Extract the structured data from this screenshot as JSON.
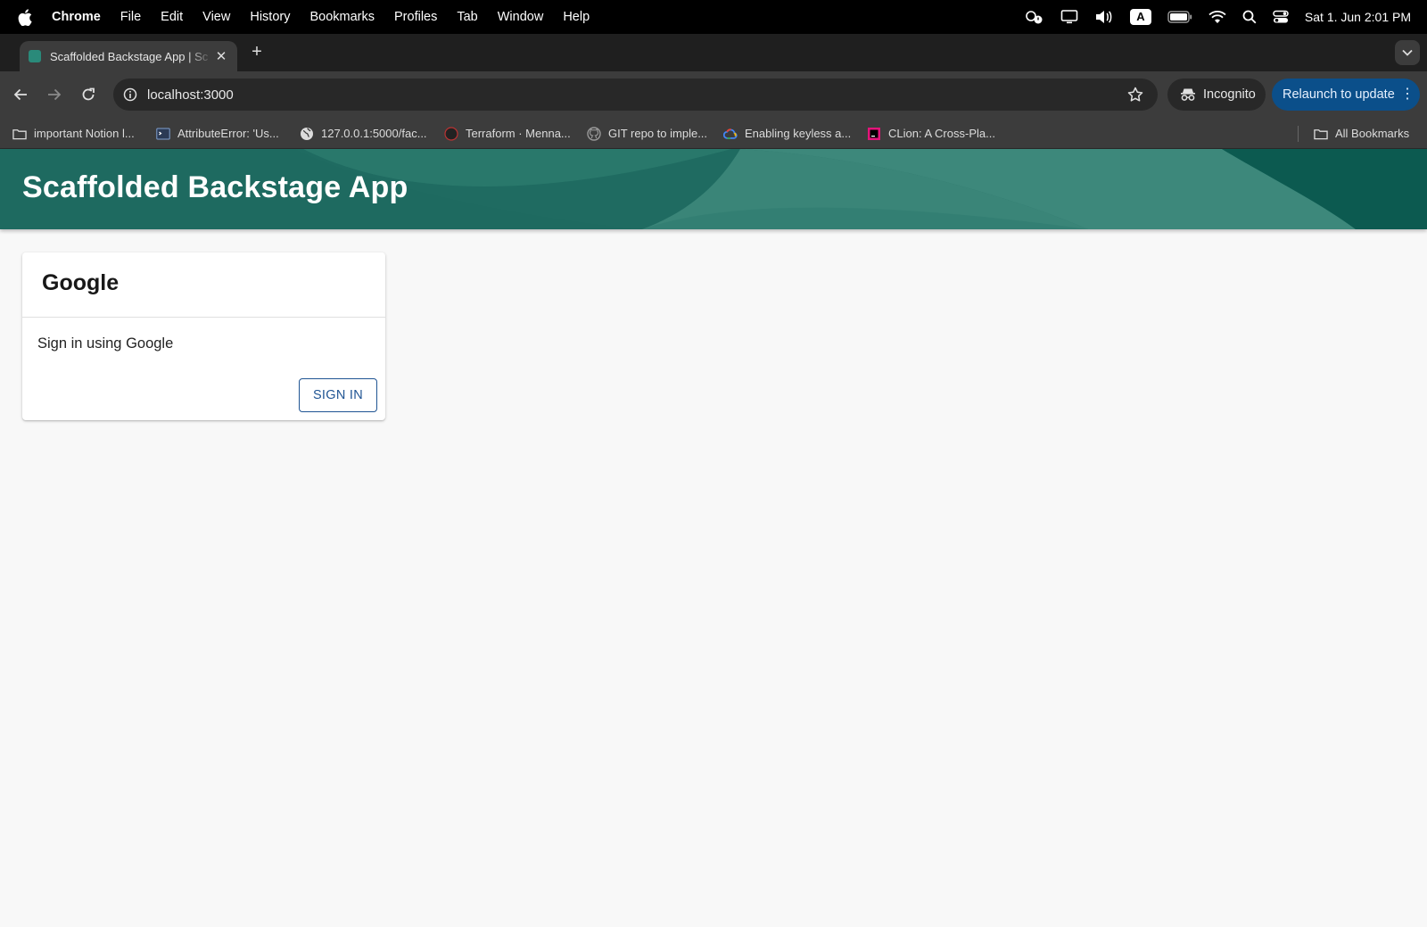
{
  "menubar": {
    "app": "Chrome",
    "items": [
      "File",
      "Edit",
      "View",
      "History",
      "Bookmarks",
      "Profiles",
      "Tab",
      "Window",
      "Help"
    ],
    "clock": "Sat 1. Jun  2:01 PM",
    "input_source": "A"
  },
  "tab": {
    "title": "Scaffolded Backstage App | Sc",
    "close": "✕",
    "new_tab": "+"
  },
  "toolbar": {
    "url": "localhost:3000",
    "incognito_label": "Incognito",
    "relaunch_label": "Relaunch to update",
    "menu_dots": "⋮"
  },
  "bookmarks": {
    "items": [
      "important Notion l...",
      "AttributeError: 'Us...",
      "127.0.0.1:5000/fac...",
      "Terraform · Menna...",
      "GIT repo to imple...",
      "Enabling keyless a...",
      "CLion: A Cross-Pla..."
    ],
    "all_bookmarks": "All Bookmarks"
  },
  "page": {
    "header_title": "Scaffolded Backstage App",
    "card": {
      "title": "Google",
      "text": "Sign in using Google",
      "button": "SIGN IN"
    }
  },
  "colors": {
    "header_bg": "#0b5d54",
    "button_accent": "#1f5493",
    "relaunch_bg": "#0b4f8a"
  }
}
